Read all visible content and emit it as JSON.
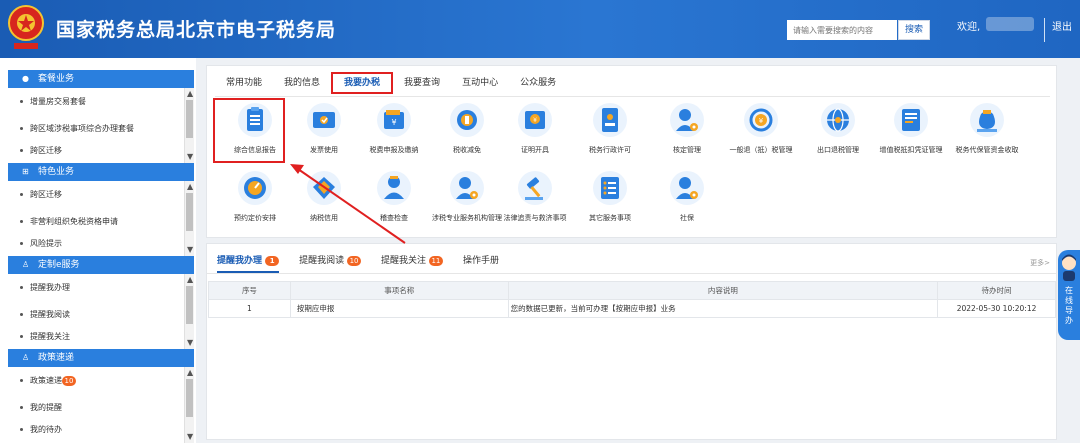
{
  "header": {
    "site_title": "国家税务总局北京市电子税务局",
    "search_placeholder": "请输入需要搜索的内容",
    "search_button": "搜索",
    "welcome": "欢迎,",
    "logout": "退出"
  },
  "sidebar": {
    "sections": [
      {
        "title": "套餐业务",
        "icon": "circle-icon",
        "items": [
          "增量房交易套餐",
          "跨区域涉税事项综合办理套餐",
          "跨区迁移"
        ]
      },
      {
        "title": "特色业务",
        "icon": "grid-icon",
        "items": [
          "跨区迁移",
          "非营利组织免税资格申请",
          "风险提示"
        ]
      },
      {
        "title": "定制e服务",
        "icon": "user-icon",
        "items": [
          "提醒我办理",
          "提醒我阅读",
          "提醒我关注"
        ]
      },
      {
        "title": "政策速递",
        "icon": "user-icon",
        "items": [
          "政策速递",
          "我的提醒",
          "我的待办"
        ],
        "badge": "10"
      }
    ]
  },
  "main": {
    "tabs": [
      "常用功能",
      "我的信息",
      "我要办税",
      "我要查询",
      "互动中心",
      "公众服务"
    ],
    "active_tab": "我要办税",
    "services": [
      {
        "label": "综合信息报告",
        "icon": "clipboard-icon"
      },
      {
        "label": "发票使用",
        "icon": "ticket-icon"
      },
      {
        "label": "税费申报及缴纳",
        "icon": "wallet-icon"
      },
      {
        "label": "税收减免",
        "icon": "coin-icon"
      },
      {
        "label": "证明开具",
        "icon": "certificate-icon"
      },
      {
        "label": "税务行政许可",
        "icon": "license-icon"
      },
      {
        "label": "核定管理",
        "icon": "user-gear-icon"
      },
      {
        "label": "一般退（抵）税管理",
        "icon": "refund-icon"
      },
      {
        "label": "出口退税管理",
        "icon": "globe-icon"
      },
      {
        "label": "增值税抵扣凭证管理",
        "icon": "document-icon"
      },
      {
        "label": "税务代保管资金收取",
        "icon": "moneybag-icon"
      },
      {
        "label": "预约定价安排",
        "icon": "gauge-icon"
      },
      {
        "label": "纳税信用",
        "icon": "diamond-icon"
      },
      {
        "label": "稽查检查",
        "icon": "inspector-icon"
      },
      {
        "label": "涉税专业服务机构管理",
        "icon": "user-gear-icon"
      },
      {
        "label": "法律追责与救济事项",
        "icon": "gavel-icon"
      },
      {
        "label": "其它服务事项",
        "icon": "list-icon"
      },
      {
        "label": "社保",
        "icon": "user-gear-icon"
      }
    ]
  },
  "reminders": {
    "tabs": [
      {
        "label": "提醒我办理",
        "badge": "1"
      },
      {
        "label": "提醒我阅读",
        "badge": "10"
      },
      {
        "label": "提醒我关注",
        "badge": "11"
      },
      {
        "label": "操作手册",
        "badge": ""
      }
    ],
    "more": "更多>",
    "columns": [
      "序号",
      "事项名称",
      "内容说明",
      "待办时间"
    ],
    "rows": [
      {
        "no": "1",
        "name": "按期应申报",
        "desc": "您的数据已更新，当前可办理【按期应申报】业务",
        "time": "2022-05-30 10:20:12"
      }
    ]
  },
  "guide": {
    "text": "在线导办"
  },
  "colors": {
    "brand_blue": "#1a5cb4",
    "accent_blue": "#2a7fde",
    "highlight_red": "#e02020",
    "badge_orange": "#f26522"
  }
}
